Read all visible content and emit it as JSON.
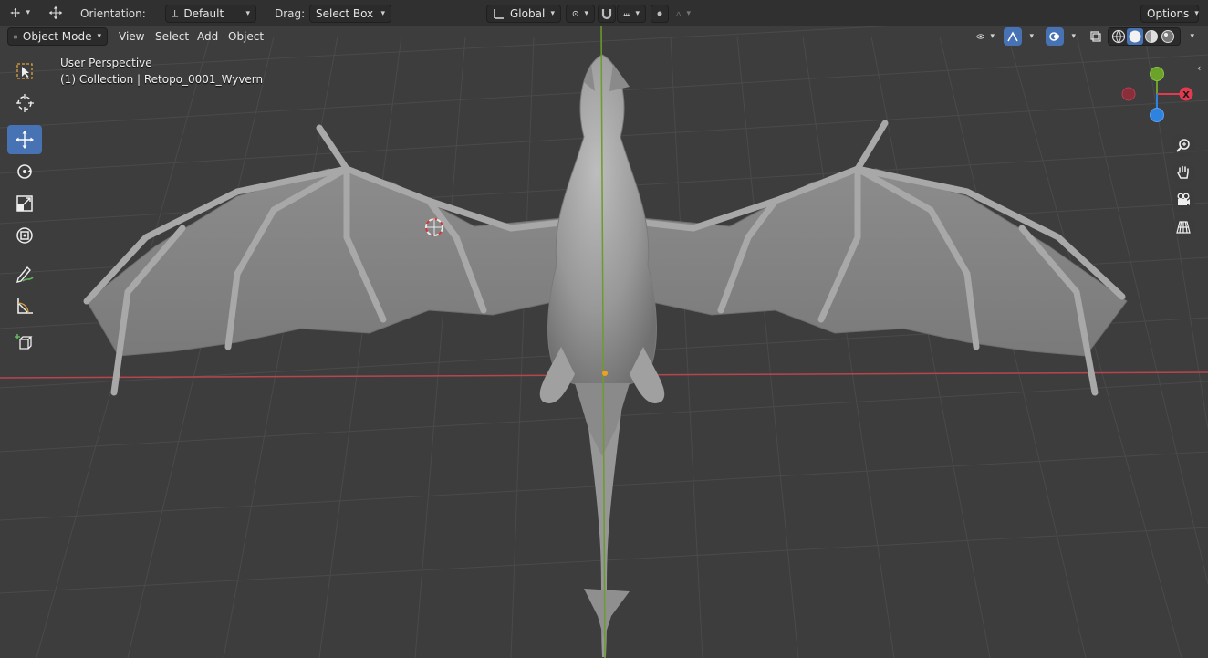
{
  "tool_header": {
    "orientation_label": "Orientation:",
    "orientation_value": "Default",
    "drag_label": "Drag:",
    "drag_value": "Select Box",
    "transform_orientation": "Global",
    "options_label": "Options"
  },
  "viewport_header": {
    "mode": "Object Mode",
    "menus": [
      "View",
      "Select",
      "Add",
      "Object"
    ]
  },
  "viewport": {
    "view_name": "User Perspective",
    "collection_info": "(1) Collection | Retopo_0001_Wyvern"
  },
  "gizmo": {
    "x_label": "X",
    "colors": {
      "x": "#e23a4f",
      "y": "#6aa22a",
      "z": "#2f83e0"
    }
  },
  "colors": {
    "header_bg": "#303030",
    "viewport_bg": "#3d3d3d",
    "accent": "#4772b3",
    "x_axis": "#b8454e",
    "y_axis": "#6d9c2c",
    "model": "#9a9a9a"
  },
  "toolbar_icons": [
    "select-box-icon",
    "cursor-icon",
    "move-icon",
    "rotate-icon",
    "scale-icon",
    "transform-icon",
    "annotate-icon",
    "measure-icon",
    "add-cube-icon"
  ]
}
